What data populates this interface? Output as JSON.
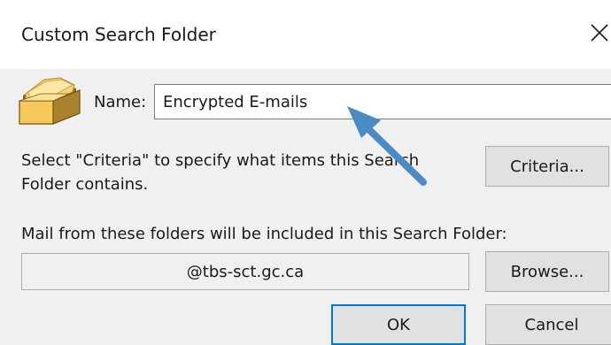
{
  "dialog": {
    "title": "Custom Search Folder",
    "close_icon": "close-icon",
    "folder_icon": "search-folder-icon"
  },
  "name_field": {
    "label": "Name:",
    "value": "Encrypted E-mails"
  },
  "criteria": {
    "description": "Select \"Criteria\" to specify what items this Search Folder contains.",
    "button_label": "Criteria..."
  },
  "folders": {
    "label": "Mail from these folders will be included in this Search Folder:",
    "value": "@tbs-sct.gc.ca",
    "browse_label": "Browse..."
  },
  "footer": {
    "ok_label": "OK",
    "cancel_label": "Cancel"
  },
  "colors": {
    "annotation_arrow": "#4a8bc4",
    "default_button_border": "#0078d7",
    "window_background": "#f0f0f0"
  }
}
